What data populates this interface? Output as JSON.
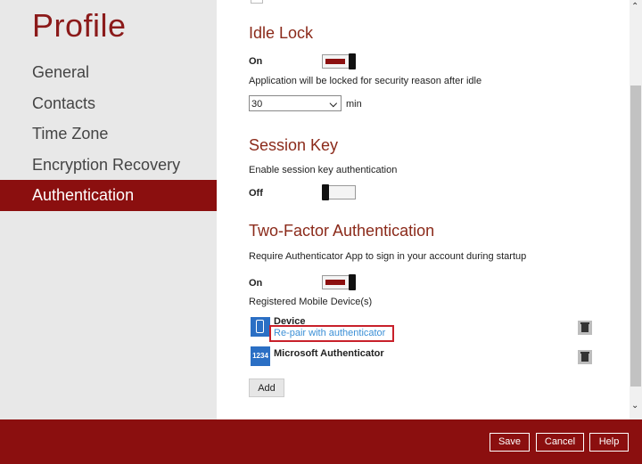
{
  "sidebar": {
    "title": "Profile",
    "items": [
      {
        "label": "General",
        "active": false
      },
      {
        "label": "Contacts",
        "active": false
      },
      {
        "label": "Time Zone",
        "active": false
      },
      {
        "label": "Encryption Recovery",
        "active": false
      },
      {
        "label": "Authentication",
        "active": true
      }
    ]
  },
  "idle_lock": {
    "title": "Idle Lock",
    "toggle_label": "On",
    "toggle_state": "on",
    "description": "Application will be locked for security reason after idle",
    "timeout_value": "30",
    "timeout_unit": "min"
  },
  "session_key": {
    "title": "Session Key",
    "description": "Enable session key authentication",
    "toggle_label": "Off",
    "toggle_state": "off"
  },
  "two_factor": {
    "title": "Two-Factor Authentication",
    "description": "Require Authenticator App to sign in your account during startup",
    "toggle_label": "On",
    "toggle_state": "on",
    "devices_label": "Registered Mobile Device(s)",
    "devices": [
      {
        "name": "Device",
        "link": "Re-pair with authenticator",
        "icon": "phone-icon"
      },
      {
        "name": "Microsoft Authenticator",
        "icon_text": "1234",
        "icon": "authenticator-icon"
      }
    ],
    "add_label": "Add"
  },
  "footer": {
    "save_label": "Save",
    "cancel_label": "Cancel",
    "help_label": "Help"
  },
  "colors": {
    "brand": "#8b0f0f",
    "sidebar_bg": "#e8e8e8",
    "link": "#3b8fd6",
    "highlight": "#c8202a",
    "device_icon": "#2b6fc4"
  }
}
